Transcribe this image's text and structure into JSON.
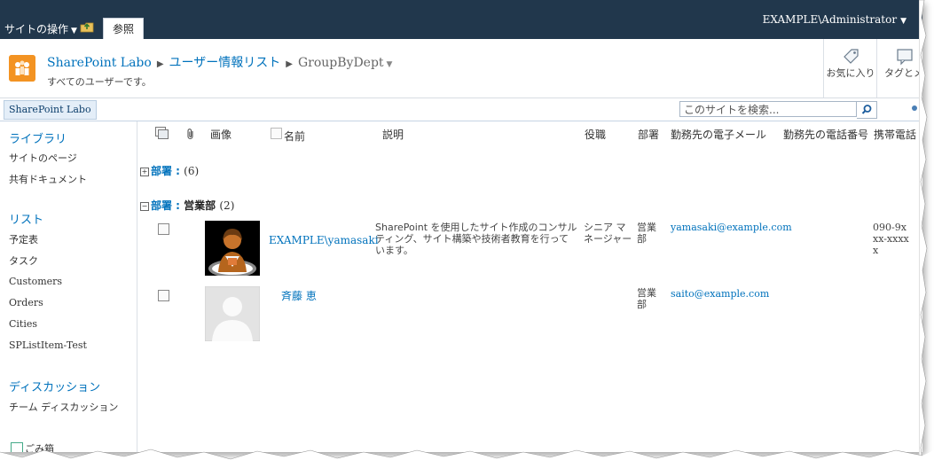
{
  "ribbon": {
    "site_actions": "サイトの操作",
    "tab_browse": "参照",
    "user": "EXAMPLE\\Administrator"
  },
  "title_area": {
    "breadcrumb": [
      "SharePoint Labo",
      "ユーザー情報リスト",
      "GroupByDept"
    ],
    "description": "すべてのユーザーです。",
    "buttons": {
      "favorite": "お気に入り",
      "tags": "タグとメ"
    }
  },
  "topnav": {
    "home": "SharePoint Labo",
    "search_placeholder": "このサイトを検索..."
  },
  "quicklaunch": {
    "sections": [
      {
        "heading": "ライブラリ",
        "items": [
          "サイトのページ",
          "共有ドキュメント"
        ]
      },
      {
        "heading": "リスト",
        "items": [
          "予定表",
          "タスク",
          "Customers",
          "Orders",
          "Cities",
          "SPListItem-Test"
        ]
      },
      {
        "heading": "ディスカッション",
        "items": [
          "チーム ディスカッション"
        ]
      }
    ],
    "recycle_bin": "ごみ箱"
  },
  "list": {
    "columns": [
      "画像",
      "名前",
      "説明",
      "役職",
      "部署",
      "勤務先の電子メール",
      "勤務先の電話番号",
      "携帯電話"
    ],
    "groups": [
      {
        "label": "部署 :",
        "value": "",
        "count": "(6)",
        "expanded": false
      },
      {
        "label": "部署 :",
        "value": "営業部",
        "count": "(2)",
        "expanded": true
      }
    ],
    "rows": [
      {
        "name": "EXAMPLE\\yamasaki",
        "description": "SharePoint を使用したサイト作成のコンサルティング、サイト構築や技術者教育を行っています。",
        "title": "シニア マネージャー",
        "dept": "営業部",
        "email": "yamasaki@example.com",
        "mobile": "090-9xxx-xxxxx"
      },
      {
        "name": "斉藤 恵",
        "description": "",
        "title": "",
        "dept": "営業部",
        "email": "saito@example.com",
        "mobile": ""
      }
    ]
  },
  "colors": {
    "ribbon_bg": "#21374c",
    "link": "#0072bc",
    "logo": "#f39322"
  }
}
